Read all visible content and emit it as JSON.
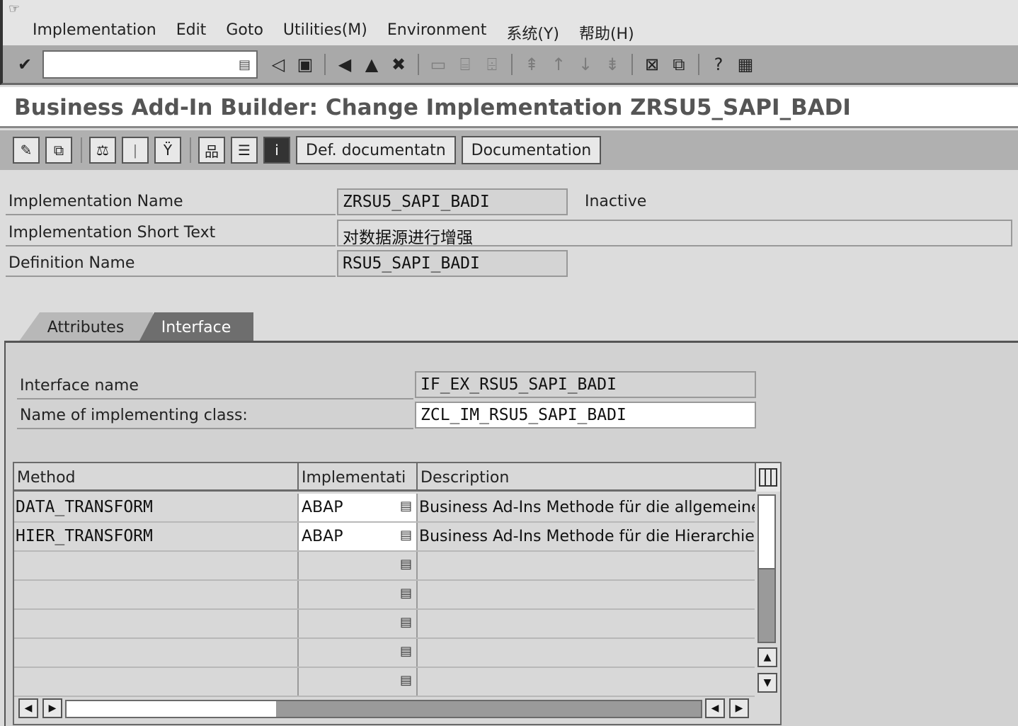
{
  "menu": {
    "items": [
      "Implementation",
      "Edit",
      "Goto",
      "Utilities(M)",
      "Environment",
      "系统(Y)",
      "帮助(H)"
    ]
  },
  "toolbar": {
    "command_field_value": "",
    "icons": [
      "enter-icon",
      "back-arrow-icon",
      "save-icon",
      "back-icon",
      "exit-icon",
      "cancel-icon",
      "print-icon",
      "find-icon",
      "find-next-icon",
      "first-page-icon",
      "previous-page-icon",
      "next-page-icon",
      "last-page-icon",
      "create-session-icon",
      "shortcut-icon",
      "help-icon",
      "customize-layout-icon"
    ]
  },
  "title": "Business Add-In Builder: Change Implementation ZRSU5_SAPI_BADI",
  "app_toolbar": {
    "def_documentation_label": "Def. documentatn",
    "documentation_label": "Documentation"
  },
  "header_fields": {
    "impl_name_label": "Implementation Name",
    "impl_name_value": "ZRSU5_SAPI_BADI",
    "impl_status": "Inactive",
    "short_text_label": "Implementation Short Text",
    "short_text_value": "对数据源进行增强",
    "def_name_label": "Definition Name",
    "def_name_value": "RSU5_SAPI_BADI"
  },
  "tabs": {
    "attributes": "Attributes",
    "interface": "Interface",
    "active": "interface"
  },
  "interface_panel": {
    "interface_name_label": "Interface name",
    "interface_name_value": "IF_EX_RSU5_SAPI_BADI",
    "class_label": "Name of implementing class:",
    "class_value": "ZCL_IM_RSU5_SAPI_BADI"
  },
  "methods_table": {
    "columns": [
      "Method",
      "Implementati",
      "Description"
    ],
    "rows": [
      {
        "method": "DATA_TRANSFORM",
        "impl": "ABAP",
        "description": "Business Ad-Ins Methode für die allgemeine"
      },
      {
        "method": "HIER_TRANSFORM",
        "impl": "ABAP",
        "description": "Business Ad-Ins Methode für die Hierarchie-D"
      },
      {
        "method": "",
        "impl": "",
        "description": ""
      },
      {
        "method": "",
        "impl": "",
        "description": ""
      },
      {
        "method": "",
        "impl": "",
        "description": ""
      },
      {
        "method": "",
        "impl": "",
        "description": ""
      },
      {
        "method": "",
        "impl": "",
        "description": ""
      }
    ]
  }
}
